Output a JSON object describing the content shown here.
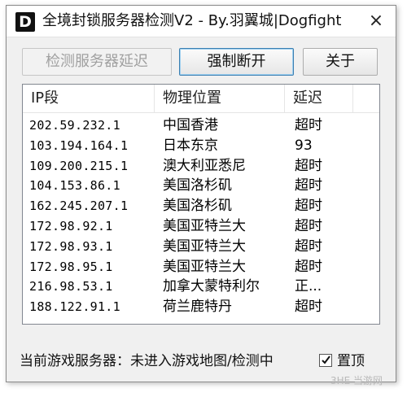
{
  "window": {
    "icon_letter": "D",
    "title": "全境封锁服务器检测V2 - By.羽翼城|Dogfight",
    "close_glyph": "×"
  },
  "toolbar": {
    "detect_label": "检测服务器延迟",
    "disconnect_label": "强制断开",
    "about_label": "关于"
  },
  "table": {
    "headers": [
      "IP段",
      "物理位置",
      "延迟"
    ],
    "rows": [
      {
        "ip": "202.59.232.1",
        "location": "中国香港",
        "latency": "超时"
      },
      {
        "ip": "103.194.164.1",
        "location": "日本东京",
        "latency": "93"
      },
      {
        "ip": "109.200.215.1",
        "location": "澳大利亚悉尼",
        "latency": "超时"
      },
      {
        "ip": "104.153.86.1",
        "location": "美国洛杉矶",
        "latency": "超时"
      },
      {
        "ip": "162.245.207.1",
        "location": "美国洛杉矶",
        "latency": "超时"
      },
      {
        "ip": "172.98.92.1",
        "location": "美国亚特兰大",
        "latency": "超时"
      },
      {
        "ip": "172.98.93.1",
        "location": "美国亚特兰大",
        "latency": "超时"
      },
      {
        "ip": "172.98.95.1",
        "location": "美国亚特兰大",
        "latency": "超时"
      },
      {
        "ip": "216.98.53.1",
        "location": "加拿大蒙特利尔",
        "latency": "正..."
      },
      {
        "ip": "188.122.91.1",
        "location": "荷兰鹿特丹",
        "latency": "超时"
      }
    ]
  },
  "status": {
    "text": "当前游戏服务器：未进入游戏地图/检测中"
  },
  "pin": {
    "label": "置顶",
    "checked": true
  },
  "watermark": {
    "text": "3HE 当游网"
  },
  "colors": {
    "window_bg": "#f0f0f0",
    "disabled_text": "#a0a0a0",
    "focus_border": "#3c7fb1"
  }
}
